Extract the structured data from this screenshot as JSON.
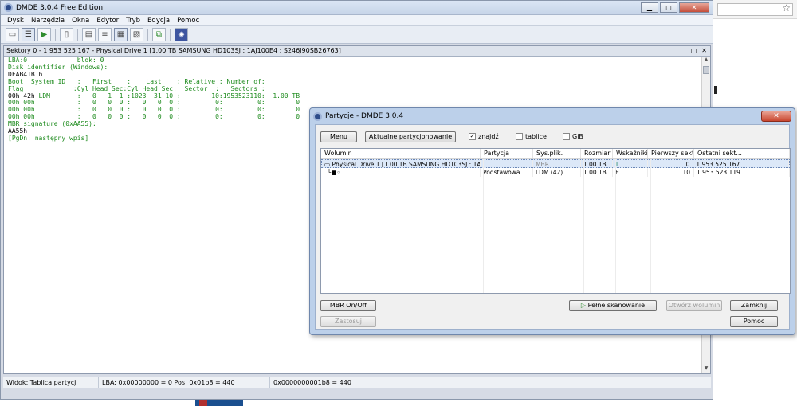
{
  "main": {
    "title": "DMDE 3.0.4 Free Edition",
    "menu": [
      "Dysk",
      "Narzędzia",
      "Okna",
      "Edytor",
      "Tryb",
      "Edycja",
      "Pomoc"
    ],
    "sector_header": "Sektory 0 - 1 953 525 167 - Physical Drive 1 [1.00 TB SAMSUNG HD103SJ : 1AJ100E4 : S246J90SB26763]",
    "hex_lines": [
      {
        "text": "LBA:0             blok: 0",
        "cls": "g"
      },
      {
        "text": "Disk identifier (Windows):",
        "cls": "g"
      },
      {
        "text": "DFAB41B1h",
        "cls": "k"
      },
      {
        "text": "Boot  System ID   :   First    :    Last    : Relative : Number of:",
        "cls": "g"
      },
      {
        "text": "Flag             :Cyl Head Sec:Cyl Head Sec:  Sector  :   Sectors :",
        "cls": "g"
      },
      {
        "text": "00h 42h LDM       :   0   1  1 :1023  31 10 :        10:1953523110:  1.00 TB",
        "cls": "mix"
      },
      {
        "text": "00h 00h           :   0   0  0 :   0   0  0 :         0:         0:        0",
        "cls": "g"
      },
      {
        "text": "00h 00h           :   0   0  0 :   0   0  0 :         0:         0:        0",
        "cls": "g"
      },
      {
        "text": "00h 00h           :   0   0  0 :   0   0  0 :         0:         0:        0",
        "cls": "g"
      },
      {
        "text": "MBR signature (0xAA55):",
        "cls": "g"
      },
      {
        "text": "AA55h",
        "cls": "k"
      },
      {
        "text": "[PgDn: następny wpis]",
        "cls": "g"
      }
    ],
    "status": {
      "view": "Widok:  Tablica partycji",
      "lba": "LBA: 0x00000000 = 0  Pos: 0x01b8 = 440",
      "offset": "0x0000000001b8 = 440"
    }
  },
  "dialog": {
    "title": "Partycje - DMDE 3.0.4",
    "menu_button": "Menu",
    "current_partitioning_button": "Aktualne partycjonowanie",
    "checkbox_find": "znajdź",
    "checkbox_tables": "tablice",
    "checkbox_gib": "GiB",
    "columns": [
      "Wolumin",
      "Partycja",
      "Sys.plik.",
      "Rozmiar",
      "Wskaźniki",
      "Pierwszy sektor",
      "Ostatni sekt..."
    ],
    "rows": [
      {
        "volume": "Physical Drive 1 [1.00 TB SAMSUNG HD103SJ : 1AJ10...",
        "partition": "",
        "fs": "MBR",
        "size": "1.00 TB",
        "flags": "T",
        "first": "0",
        "last": "1 953 525 167"
      },
      {
        "volume": "",
        "partition": "Podstawowa",
        "fs": "LDM (42)",
        "size": "1.00 TB",
        "flags": "E",
        "first": "10",
        "last": "1 953 523 119"
      }
    ],
    "buttons": {
      "mbr": "MBR On/Off",
      "apply": "Zastosuj",
      "full_scan": "Pełne skanowanie",
      "open_volume": "Otwórz wolumin",
      "close": "Zamknij",
      "help": "Pomoc"
    }
  }
}
